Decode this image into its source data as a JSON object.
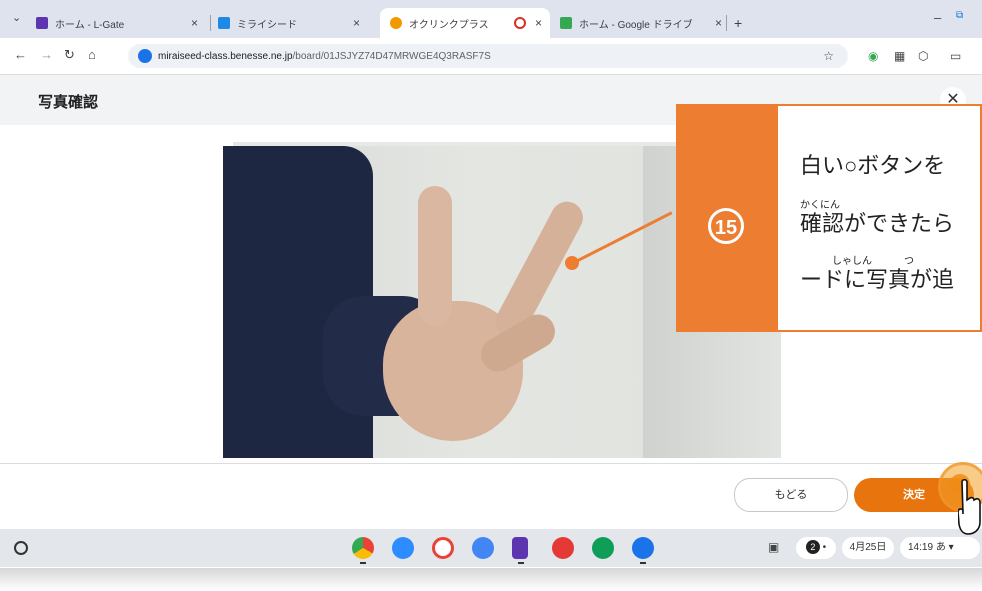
{
  "browser": {
    "tabs": [
      {
        "label": "ホーム - L-Gate",
        "fav": "#5e35b1"
      },
      {
        "label": "ミライシード",
        "fav": "#1e88e5"
      },
      {
        "label": "オクリンクプラス",
        "fav": "#f29900"
      },
      {
        "label": "ホーム - Google ドライブ",
        "fav": "#34a853"
      }
    ],
    "new_tab": "+",
    "url_host": "miraiseed-class.benesse.ne.jp",
    "url_path": "/board/01JSJYZ74D47MRWGE4Q3RASF7S"
  },
  "app": {
    "title": "写真確認",
    "close": "✕",
    "back_label": "もどる",
    "confirm_label": "決定"
  },
  "callout": {
    "number": "15",
    "line1": "白い○ボタンを",
    "line2": "確認ができたら",
    "line3": "ードに写真が追",
    "ruby1": "かくにん",
    "ruby2": "しゃしん",
    "ruby3": "つ"
  },
  "shelf": {
    "date": "4月25日",
    "time": "14:19",
    "ime": "あ",
    "badge": "2"
  },
  "colors": {
    "accent": "#e8740e",
    "callout": "#ed7d31"
  }
}
